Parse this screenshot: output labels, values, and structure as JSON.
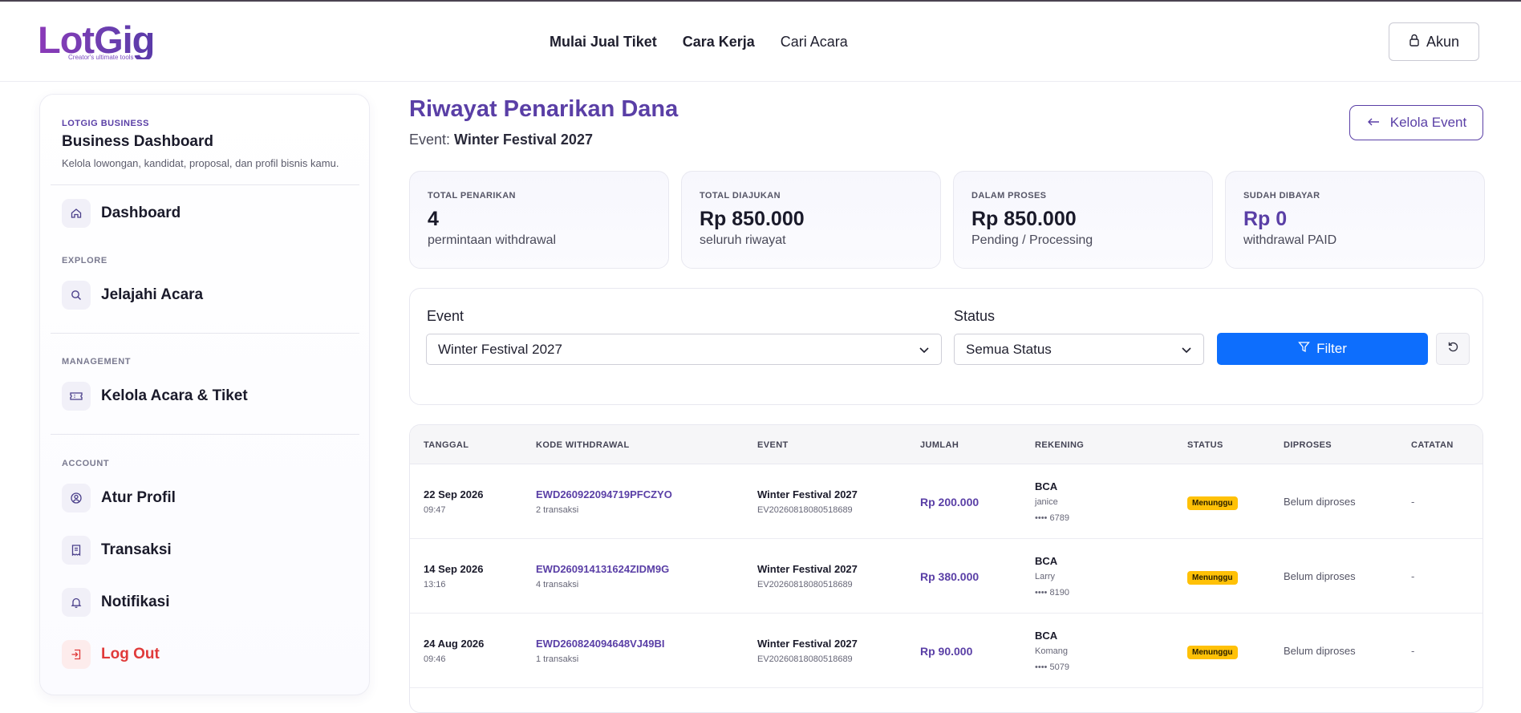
{
  "brand": {
    "name": "LotGig",
    "tagline": "Creator's ultimate tools"
  },
  "nav": {
    "items": [
      "Mulai Jual Tiket",
      "Cara Kerja",
      "Cari Acara"
    ]
  },
  "account_button": "Akun",
  "sidebar": {
    "kicker": "LOTGIG BUSINESS",
    "title": "Business Dashboard",
    "description": "Kelola lowongan, kandidat, proposal, dan profil bisnis kamu.",
    "dashboard": "Dashboard",
    "explore_label": "EXPLORE",
    "jelajahi": "Jelajahi Acara",
    "management_label": "MANAGEMENT",
    "kelola": "Kelola Acara & Tiket",
    "account_label": "ACCOUNT",
    "profil": "Atur Profil",
    "transaksi": "Transaksi",
    "notifikasi": "Notifikasi",
    "logout": "Log Out"
  },
  "page": {
    "title": "Riwayat Penarikan Dana",
    "event_prefix": "Event:",
    "event_name": "Winter Festival 2027",
    "back_button": "Kelola Event"
  },
  "stats": [
    {
      "key": "TOTAL PENARIKAN",
      "value": "4",
      "sub": "permintaan withdrawal"
    },
    {
      "key": "TOTAL DIAJUKAN",
      "value": "Rp 850.000",
      "sub": "seluruh riwayat"
    },
    {
      "key": "DALAM PROSES",
      "value": "Rp 850.000",
      "sub": "Pending / Processing"
    },
    {
      "key": "SUDAH DIBAYAR",
      "value": "Rp 0",
      "sub": "withdrawal PAID"
    }
  ],
  "filters": {
    "event_label": "Event",
    "event_value": "Winter Festival 2027",
    "status_label": "Status",
    "status_value": "Semua Status",
    "filter_button": "Filter"
  },
  "table": {
    "headers": [
      "TANGGAL",
      "KODE WITHDRAWAL",
      "EVENT",
      "JUMLAH",
      "REKENING",
      "STATUS",
      "DIPROSES",
      "CATATAN"
    ],
    "rows": [
      {
        "date": "22 Sep 2026",
        "time": "09:47",
        "code": "EWD260922094719PFCZYO",
        "trx": "2 transaksi",
        "event": "Winter Festival 2027",
        "event_id": "EV20260818080518689",
        "amount": "Rp 200.000",
        "bank": "BCA",
        "holder": "janice",
        "account": "•••• 6789",
        "status": "Menunggu",
        "processed": "Belum diproses",
        "note": "-"
      },
      {
        "date": "14 Sep 2026",
        "time": "13:16",
        "code": "EWD260914131624ZIDM9G",
        "trx": "4 transaksi",
        "event": "Winter Festival 2027",
        "event_id": "EV20260818080518689",
        "amount": "Rp 380.000",
        "bank": "BCA",
        "holder": "Larry",
        "account": "•••• 8190",
        "status": "Menunggu",
        "processed": "Belum diproses",
        "note": "-"
      },
      {
        "date": "24 Aug 2026",
        "time": "09:46",
        "code": "EWD260824094648VJ49BI",
        "trx": "1 transaksi",
        "event": "Winter Festival 2027",
        "event_id": "EV20260818080518689",
        "amount": "Rp 90.000",
        "bank": "BCA",
        "holder": "Komang",
        "account": "•••• 5079",
        "status": "Menunggu",
        "processed": "Belum diproses",
        "note": "-"
      }
    ]
  },
  "colors": {
    "accent": "#5a3fa6",
    "primary_button": "#0d6efd",
    "status_pending": "#ffc107",
    "logout": "#e03a3a"
  }
}
